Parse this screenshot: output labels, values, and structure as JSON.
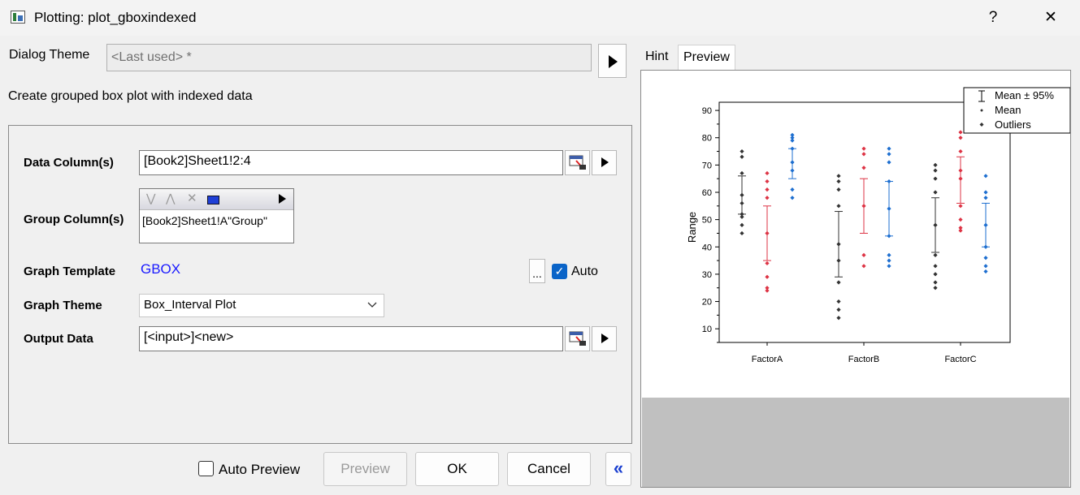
{
  "window": {
    "title": "Plotting: plot_gboxindexed",
    "help": "?",
    "close": "✕"
  },
  "theme": {
    "label": "Dialog Theme",
    "value": "<Last used> *"
  },
  "description": "Create grouped box plot with indexed data",
  "form": {
    "data_columns": {
      "label": "Data Column(s)",
      "value": "[Book2]Sheet1!2:4"
    },
    "group_columns": {
      "label": "Group Column(s)",
      "value": "[Book2]Sheet1!A\"Group\""
    },
    "graph_template": {
      "label": "Graph Template",
      "value": "GBOX",
      "ellipsis": "...",
      "auto_label": "Auto",
      "auto_checked": true
    },
    "graph_theme": {
      "label": "Graph Theme",
      "value": "Box_Interval Plot"
    },
    "output_data": {
      "label": "Output Data",
      "value": "[<input>]<new>"
    }
  },
  "tabs": [
    {
      "label": "Hint"
    },
    {
      "label": "Preview",
      "active": true
    }
  ],
  "footer": {
    "auto_preview": "Auto Preview",
    "auto_preview_checked": false,
    "preview": "Preview",
    "ok": "OK",
    "cancel": "Cancel",
    "collapse": "«"
  },
  "legend": [
    "Mean ± 95%",
    "Mean",
    "Outliers"
  ],
  "colors": {
    "black_series": "#333333",
    "red_series": "#dd3344",
    "blue_series": "#1e6fd0",
    "link": "#1a1aff",
    "check": "#0a64c8"
  },
  "chart_data": {
    "type": "scatter",
    "ylabel": "Range",
    "ylim": [
      5,
      93
    ],
    "yticks": [
      10,
      20,
      30,
      40,
      50,
      60,
      70,
      80,
      90
    ],
    "categories": [
      "FactorA",
      "FactorB",
      "FactorC"
    ],
    "series": [
      {
        "groups": [
          {
            "points": [
              75,
              73,
              67,
              59,
              56,
              52,
              51,
              48,
              45
            ],
            "mean": 59,
            "ci": [
              52,
              66
            ]
          },
          {
            "points": [
              66,
              64,
              61,
              55,
              41,
              35,
              27,
              20,
              17,
              14
            ],
            "mean": 41,
            "ci": [
              29,
              53
            ]
          },
          {
            "points": [
              70,
              68,
              65,
              60,
              48,
              37,
              33,
              30,
              27,
              25
            ],
            "mean": 48,
            "ci": [
              38,
              58
            ]
          }
        ]
      },
      {
        "groups": [
          {
            "points": [
              67,
              64,
              61,
              58,
              45,
              34,
              29,
              25,
              24
            ],
            "mean": 45,
            "ci": [
              35,
              55
            ]
          },
          {
            "points": [
              76,
              74,
              69,
              55,
              37,
              33
            ],
            "mean": 55,
            "ci": [
              45,
              65
            ]
          },
          {
            "points": [
              82,
              80,
              75,
              68,
              65,
              55,
              50,
              47,
              46
            ],
            "mean": 65,
            "ci": [
              56,
              73
            ]
          }
        ]
      },
      {
        "groups": [
          {
            "points": [
              81,
              80,
              79,
              76,
              71,
              68,
              61,
              58
            ],
            "mean": 71,
            "ci": [
              65,
              76
            ]
          },
          {
            "points": [
              76,
              74,
              71,
              64,
              54,
              44,
              37,
              35,
              33
            ],
            "mean": 54,
            "ci": [
              44,
              64
            ]
          },
          {
            "points": [
              66,
              60,
              58,
              48,
              40,
              36,
              33,
              31
            ],
            "mean": 48,
            "ci": [
              40,
              56
            ]
          }
        ]
      }
    ]
  }
}
